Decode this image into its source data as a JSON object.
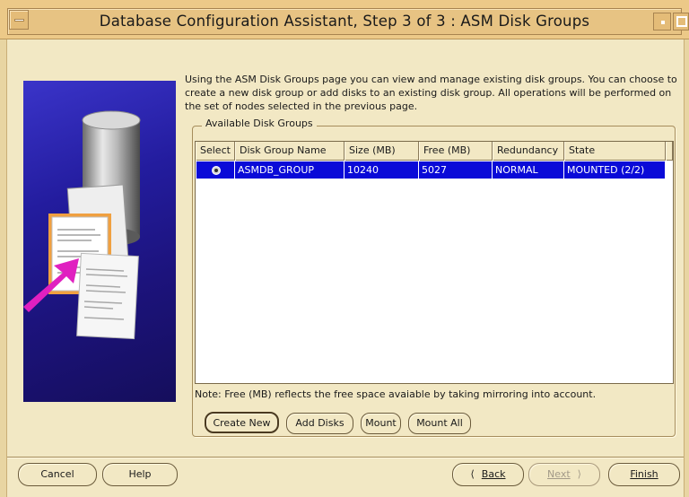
{
  "window": {
    "title": "Database Configuration Assistant, Step 3 of 3 : ASM Disk Groups"
  },
  "main": {
    "description": "Using the ASM Disk Groups page you can view and manage existing disk groups.  You can choose to create a new disk group or add disks to an existing disk group.  All operations will be performed on the set of nodes selected in the previous page.",
    "group_title": "Available Disk Groups",
    "table": {
      "columns": [
        "Select",
        "Disk Group Name",
        "Size (MB)",
        "Free (MB)",
        "Redundancy",
        "State"
      ],
      "rows": [
        {
          "selected": true,
          "name": "ASMDB_GROUP",
          "size": "10240",
          "free": "5027",
          "redundancy": "NORMAL",
          "state": "MOUNTED (2/2)"
        }
      ]
    },
    "note": "Note: Free (MB) reflects the free space avaiable by taking mirroring into account.",
    "buttons": {
      "create_new": "Create New",
      "add_disks": "Add Disks",
      "mount": "Mount",
      "mount_all": "Mount All"
    }
  },
  "footer": {
    "cancel": "Cancel",
    "help": "Help",
    "back": "Back",
    "next": "Next",
    "finish": "Finish"
  },
  "colors": {
    "background": "#f2e8c4",
    "titlebar": "#ecc988",
    "selection": "#0a0ad8",
    "illustration": "#231c9e",
    "arrow": "#e020c0"
  },
  "icons": {
    "back": "back-arrow-icon",
    "next": "next-arrow-icon",
    "window_menu": "window-menu-icon"
  }
}
